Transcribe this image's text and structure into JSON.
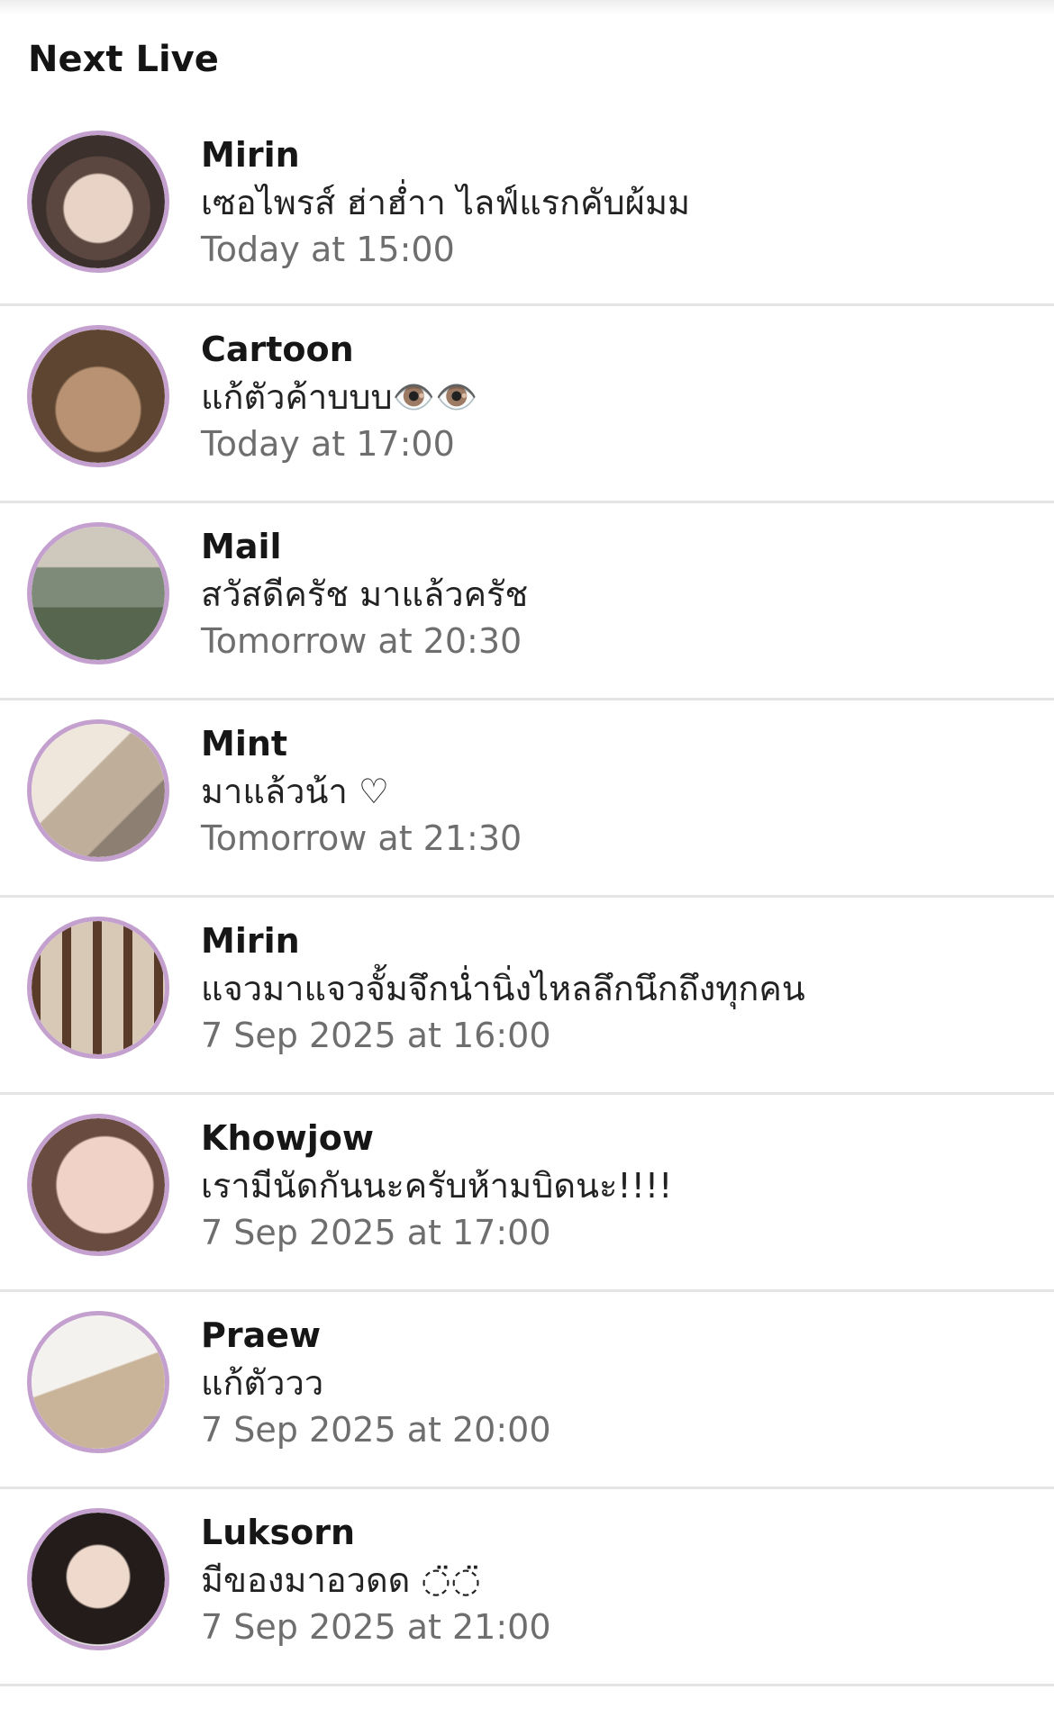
{
  "section": {
    "title": "Next Live"
  },
  "accent_color": "#c4a0cf",
  "lives": [
    {
      "name": "Mirin",
      "message": "เซอไพรส์ ฮ่าฮ่ำา ไลฟ์แรกคับผ้มม",
      "time": "Today at 15:00"
    },
    {
      "name": "Cartoon",
      "message": "แก้ตัวค้าบบบ👁️👁️",
      "time": "Today at 17:00"
    },
    {
      "name": "Mail",
      "message": "สวัสดีครัช มาแล้วครัช",
      "time": "Tomorrow at 20:30"
    },
    {
      "name": "Mint",
      "message": "มาแล้วน้า ♡",
      "time": "Tomorrow at 21:30"
    },
    {
      "name": "Mirin",
      "message": "แจวมาแจวจั้มจึกน่ำนิ่งไหลลึกนึกถึงทุกคน",
      "time": "7 Sep 2025 at 16:00"
    },
    {
      "name": "Khowjow",
      "message": "เรามีนัดกันนะครับห้ามบิดนะ!!!!",
      "time": "7 Sep 2025 at 17:00"
    },
    {
      "name": "Praew",
      "message": "แก้ตัววว",
      "time": "7 Sep 2025 at 20:00"
    },
    {
      "name": "Luksorn",
      "message": "มีของมาอวดด ◌̈◌̈",
      "time": "7 Sep 2025 at 21:00"
    }
  ]
}
